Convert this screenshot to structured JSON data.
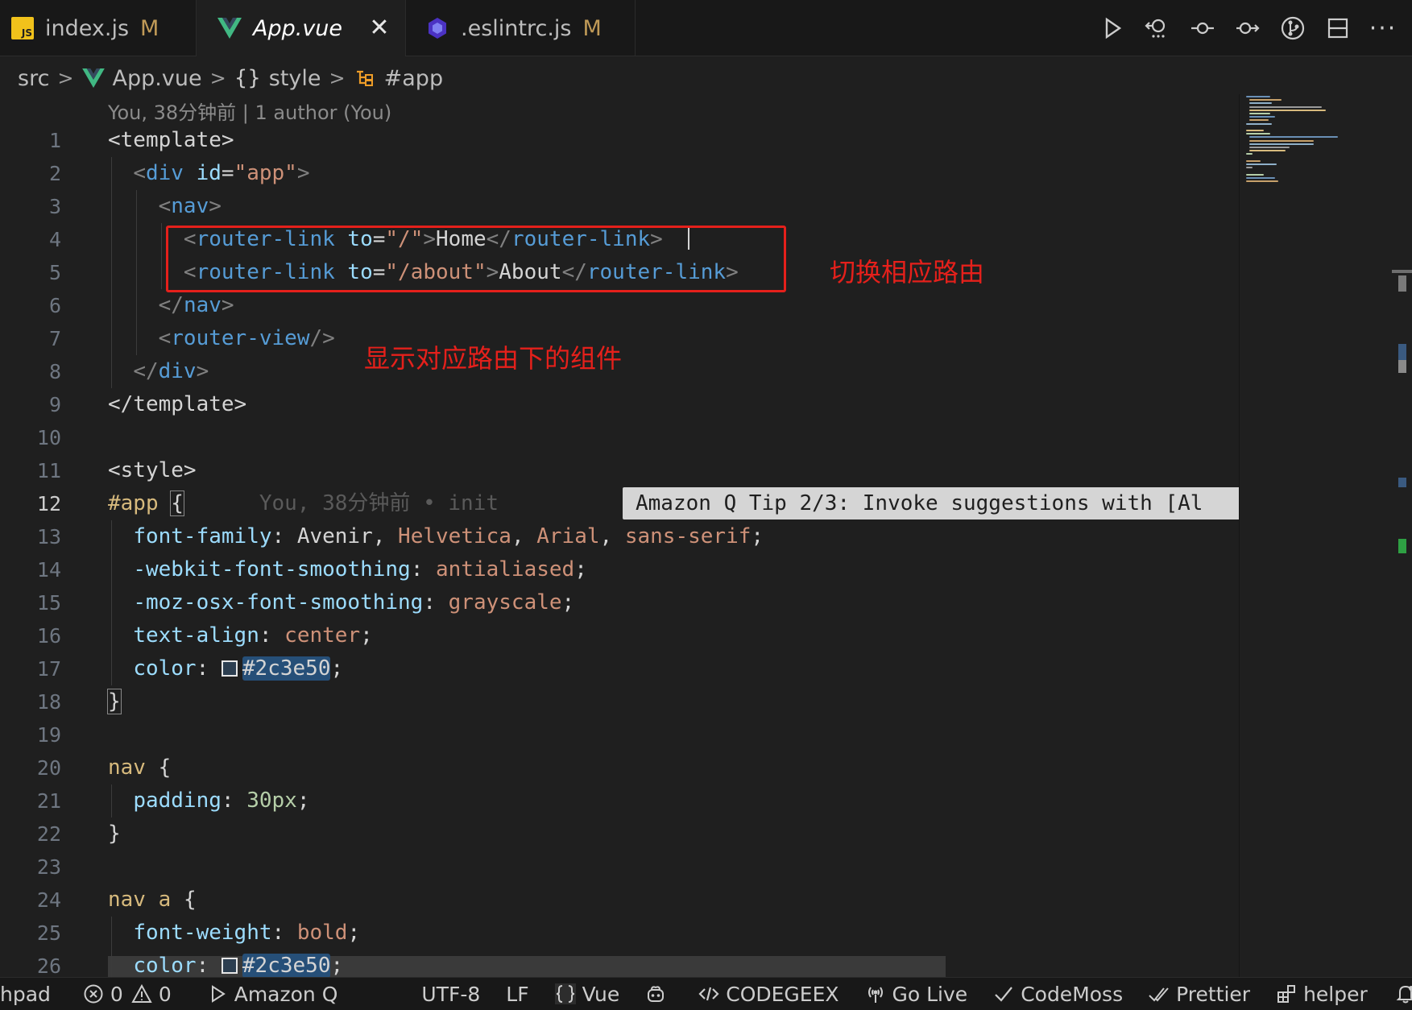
{
  "tabs": [
    {
      "label": "index.js",
      "modified": "M",
      "icon": "js-file-icon"
    },
    {
      "label": "App.vue",
      "modified": "",
      "icon": "vue-file-icon",
      "close": "✕"
    },
    {
      "label": ".eslintrc.js",
      "modified": "M",
      "icon": "eslint-file-icon"
    }
  ],
  "toolbar": {
    "more": "···",
    "js_badge": "JS"
  },
  "breadcrumb": {
    "folder": "src",
    "file": "App.vue",
    "block": "style",
    "block_glyph": "{}",
    "symbol": "#app"
  },
  "blame": {
    "header": "You, 38分钟前 | 1 author (You)",
    "inline": "You, 38分钟前 • init"
  },
  "line_numbers": [
    "1",
    "2",
    "3",
    "4",
    "5",
    "6",
    "7",
    "8",
    "9",
    "10",
    "11",
    "12",
    "13",
    "14",
    "15",
    "16",
    "17",
    "18",
    "19",
    "20",
    "21",
    "22",
    "23",
    "24",
    "25",
    "26"
  ],
  "current_line": "12",
  "code": {
    "l1": "<template>",
    "l2_tag": "div",
    "l2_attr": "id",
    "l2_val": "\"app\"",
    "l3_tag": "nav",
    "l4_tag": "router-link",
    "l4_attr": "to",
    "l4_val": "\"/\"",
    "l4_text": "Home",
    "l5_tag": "router-link",
    "l5_attr": "to",
    "l5_val": "\"/about\"",
    "l5_text": "About",
    "l6_tag": "nav",
    "l7_tag": "router-view",
    "l8_tag": "div",
    "l9": "</template>",
    "l11": "<style>",
    "l12_selector": "#app",
    "l12_brace": "{",
    "l13_prop": "font-family",
    "l13_v1": "Avenir",
    "l13_v2": "Helvetica",
    "l13_v3": "Arial",
    "l13_v4": "sans-serif",
    "l14_prop": "-webkit-font-smoothing",
    "l14_val": "antialiased",
    "l15_prop": "-moz-osx-font-smoothing",
    "l15_val": "grayscale",
    "l16_prop": "text-align",
    "l16_val": "center",
    "l17_prop": "color",
    "l17_val": "#2c3e50",
    "l18": "}",
    "l20_selector": "nav",
    "l20_brace": "{",
    "l21_prop": "padding",
    "l21_val": "30px",
    "l22": "}",
    "l24_selector": "nav a",
    "l24_brace": "{",
    "l25_prop": "font-weight",
    "l25_val": "bold",
    "l26_prop": "color",
    "l26_val": "#2c3e50"
  },
  "annotations": {
    "switch_route": "切换相应路由",
    "show_component": "显示对应路由下的组件"
  },
  "amazon_q_tip": "Amazon Q Tip 2/3: Invoke suggestions with [Al",
  "statusbar": {
    "left_cut": "hpad",
    "errors": "0",
    "warnings": "0",
    "amazon_q": "Amazon Q",
    "encoding": "UTF-8",
    "eol": "LF",
    "language": "Vue",
    "codegeex": "CODEGEEX",
    "go_live": "Go Live",
    "codemoss": "CodeMoss",
    "prettier": "Prettier",
    "helper": "helper"
  },
  "colors": {
    "accent_red": "#e5201b",
    "swatch": "#2c3e50",
    "vue_green": "#41b883",
    "js_yellow": "#f1c21b"
  }
}
